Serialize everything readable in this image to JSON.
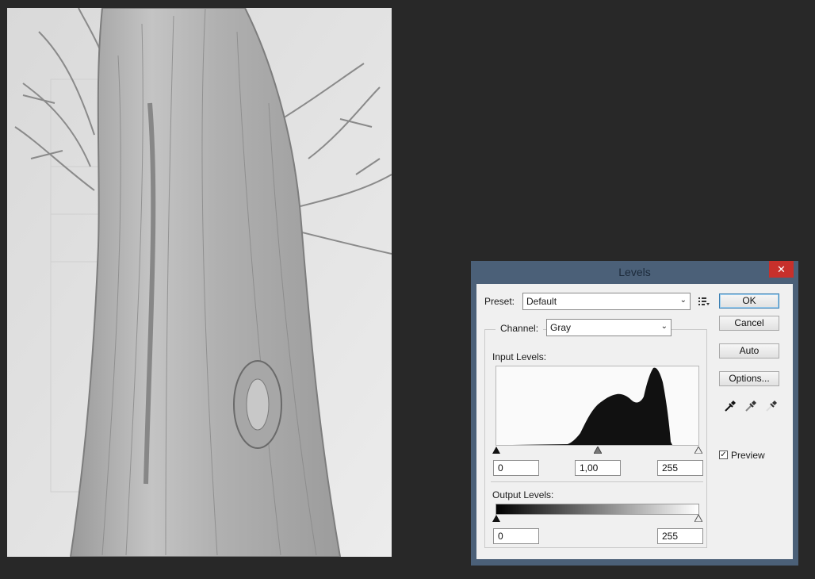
{
  "dialog": {
    "title": "Levels",
    "close_glyph": "✕",
    "preset_label": "Preset:",
    "preset_value": "Default",
    "channel_label": "Channel:",
    "channel_value": "Gray",
    "input_levels_label": "Input Levels:",
    "input_black": "0",
    "input_gamma": "1,00",
    "input_white": "255",
    "output_levels_label": "Output Levels:",
    "output_black": "0",
    "output_white": "255",
    "buttons": {
      "ok": "OK",
      "cancel": "Cancel",
      "auto": "Auto",
      "options": "Options..."
    },
    "preview_label": "Preview",
    "preview_checked": true,
    "icons": [
      "preset-options-icon",
      "black-eyedropper-icon",
      "gray-eyedropper-icon",
      "white-eyedropper-icon",
      "chevron-down-icon"
    ]
  }
}
